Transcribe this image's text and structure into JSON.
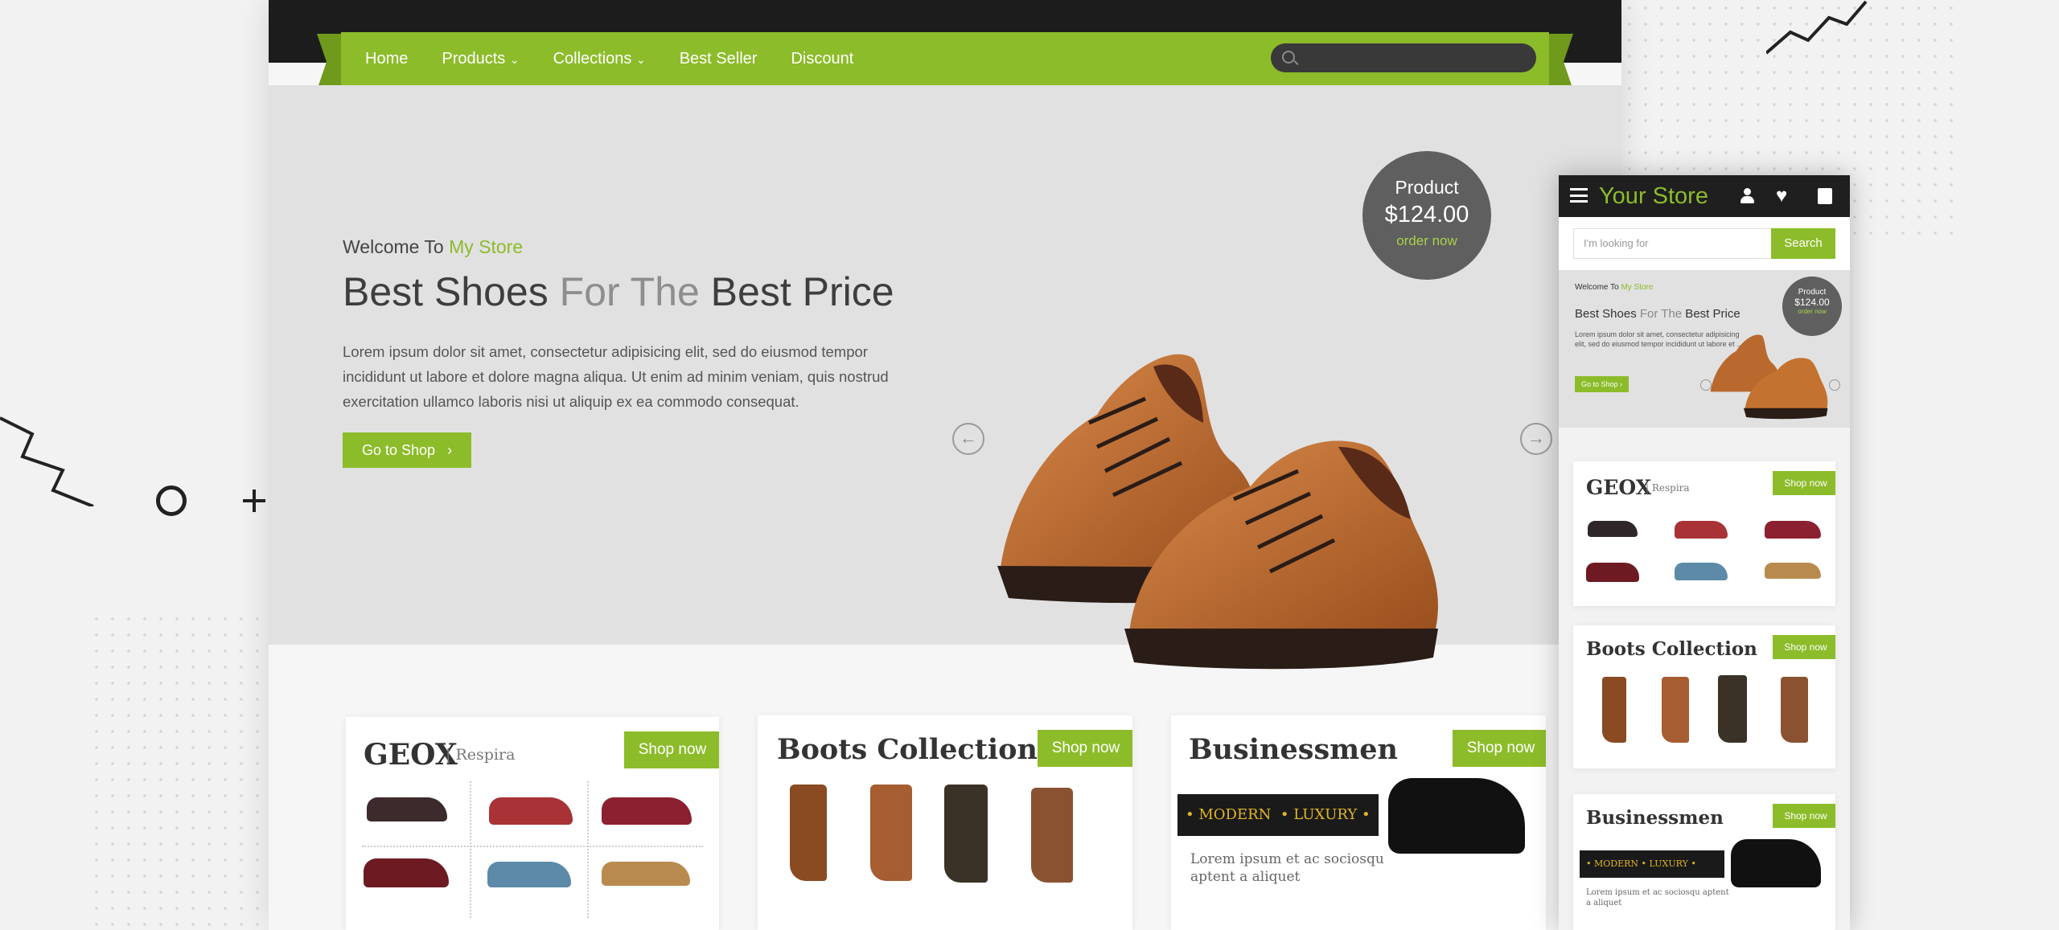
{
  "nav": {
    "items": [
      "Home",
      "Products",
      "Collections",
      "Best Seller",
      "Discount"
    ],
    "chevron": "⌄"
  },
  "hero": {
    "welcome_prefix": "Welcome To ",
    "welcome_store": "My Store",
    "title_a": "Best Shoes ",
    "title_b": "For The",
    "title_c": " Best Price",
    "text": "Lorem ipsum dolor sit amet, consectetur adipisicing elit, sed do eiusmod tempor incididunt ut labore et dolore magna aliqua. Ut enim ad minim veniam, quis nostrud exercitation ullamco laboris nisi ut aliquip ex ea commodo consequat.",
    "cta": "Go to Shop",
    "cta_arrow": "›",
    "prev": "←",
    "next": "→"
  },
  "badge": {
    "label": "Product",
    "price": "$124.00",
    "order": "order now"
  },
  "cards": {
    "geox": {
      "brand": "GEOX",
      "sub": "| Respira",
      "shop": "Shop now"
    },
    "boots": {
      "title": "Boots Collection",
      "shop": "Shop now"
    },
    "business": {
      "title": "Businessmen",
      "modern": "MODERN",
      "luxury": "LUXURY",
      "text": "Lorem ipsum et ac sociosqu aptent a aliquet",
      "shop": "Shop now"
    }
  },
  "mobile": {
    "title": "Your Store",
    "search_placeholder": "I'm looking for",
    "search_button": "Search",
    "welcome_prefix": "Welcome To ",
    "welcome_store": "My Store",
    "hero_title_a": "Best Shoes ",
    "hero_title_b": "For The",
    "hero_title_c": " Best Price",
    "hero_text": "Lorem ipsum dolor sit amet, consectetur adipisicing elit, sed do eiusmod tempor incididunt ut labore et ...",
    "cta": "Go to Shop",
    "badge_label": "Product",
    "badge_price": "$124.00",
    "badge_order": "order now",
    "geox": "GEOX",
    "geox_sub": "| Respira",
    "boots": "Boots Collection",
    "business": "Businessmen",
    "modern": "MODERN",
    "luxury": "LUXURY",
    "business_text": "Lorem ipsum et ac sociosqu aptent a aliquet",
    "shop": "Shop now"
  },
  "colors": {
    "accent": "#8cbc2a",
    "dark": "#1c1c1c",
    "gold": "#e2b624"
  }
}
